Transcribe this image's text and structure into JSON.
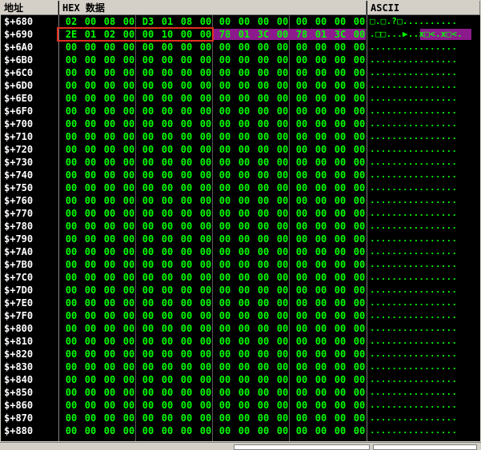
{
  "columns": {
    "address": "地址",
    "hex": "HEX 数据",
    "ascii": "ASCII"
  },
  "colors": {
    "background": "#000000",
    "hex_text": "#00ff00",
    "address_text": "#ffffff",
    "selection_purple": "#8c1a8c",
    "box_red": "#e0301e"
  },
  "rows": [
    {
      "address": "$+680",
      "bytes": [
        "02",
        "00",
        "08",
        "00",
        "D3",
        "01",
        "08",
        "00",
        "00",
        "00",
        "00",
        "00",
        "00",
        "00",
        "00",
        "00"
      ],
      "ascii": "□.□.?□.........."
    },
    {
      "address": "$+690",
      "bytes": [
        "2E",
        "01",
        "02",
        "00",
        "00",
        "10",
        "00",
        "00",
        "78",
        "01",
        "3C",
        "00",
        "78",
        "01",
        "3C",
        "00"
      ],
      "ascii": ".□□...▶..x□<.x□<."
    },
    {
      "address": "$+6A0",
      "bytes": [],
      "ascii": ""
    },
    {
      "address": "$+6B0",
      "bytes": [],
      "ascii": ""
    },
    {
      "address": "$+6C0",
      "bytes": [],
      "ascii": ""
    },
    {
      "address": "$+6D0",
      "bytes": [],
      "ascii": ""
    },
    {
      "address": "$+6E0",
      "bytes": [],
      "ascii": ""
    },
    {
      "address": "$+6F0",
      "bytes": [],
      "ascii": ""
    },
    {
      "address": "$+700",
      "bytes": [],
      "ascii": ""
    },
    {
      "address": "$+710",
      "bytes": [],
      "ascii": ""
    },
    {
      "address": "$+720",
      "bytes": [],
      "ascii": ""
    },
    {
      "address": "$+730",
      "bytes": [],
      "ascii": ""
    },
    {
      "address": "$+740",
      "bytes": [],
      "ascii": ""
    },
    {
      "address": "$+750",
      "bytes": [],
      "ascii": ""
    },
    {
      "address": "$+760",
      "bytes": [],
      "ascii": ""
    },
    {
      "address": "$+770",
      "bytes": [],
      "ascii": ""
    },
    {
      "address": "$+780",
      "bytes": [],
      "ascii": ""
    },
    {
      "address": "$+790",
      "bytes": [],
      "ascii": ""
    },
    {
      "address": "$+7A0",
      "bytes": [],
      "ascii": ""
    },
    {
      "address": "$+7B0",
      "bytes": [],
      "ascii": ""
    },
    {
      "address": "$+7C0",
      "bytes": [],
      "ascii": ""
    },
    {
      "address": "$+7D0",
      "bytes": [],
      "ascii": ""
    },
    {
      "address": "$+7E0",
      "bytes": [],
      "ascii": ""
    },
    {
      "address": "$+7F0",
      "bytes": [],
      "ascii": ""
    },
    {
      "address": "$+800",
      "bytes": [],
      "ascii": ""
    },
    {
      "address": "$+810",
      "bytes": [],
      "ascii": ""
    },
    {
      "address": "$+820",
      "bytes": [],
      "ascii": ""
    },
    {
      "address": "$+830",
      "bytes": [],
      "ascii": ""
    },
    {
      "address": "$+840",
      "bytes": [],
      "ascii": ""
    },
    {
      "address": "$+850",
      "bytes": [],
      "ascii": ""
    },
    {
      "address": "$+860",
      "bytes": [],
      "ascii": ""
    },
    {
      "address": "$+870",
      "bytes": [],
      "ascii": ""
    },
    {
      "address": "$+880",
      "bytes": [],
      "ascii": ""
    }
  ],
  "default_byte": "00",
  "default_ascii": "................"
}
